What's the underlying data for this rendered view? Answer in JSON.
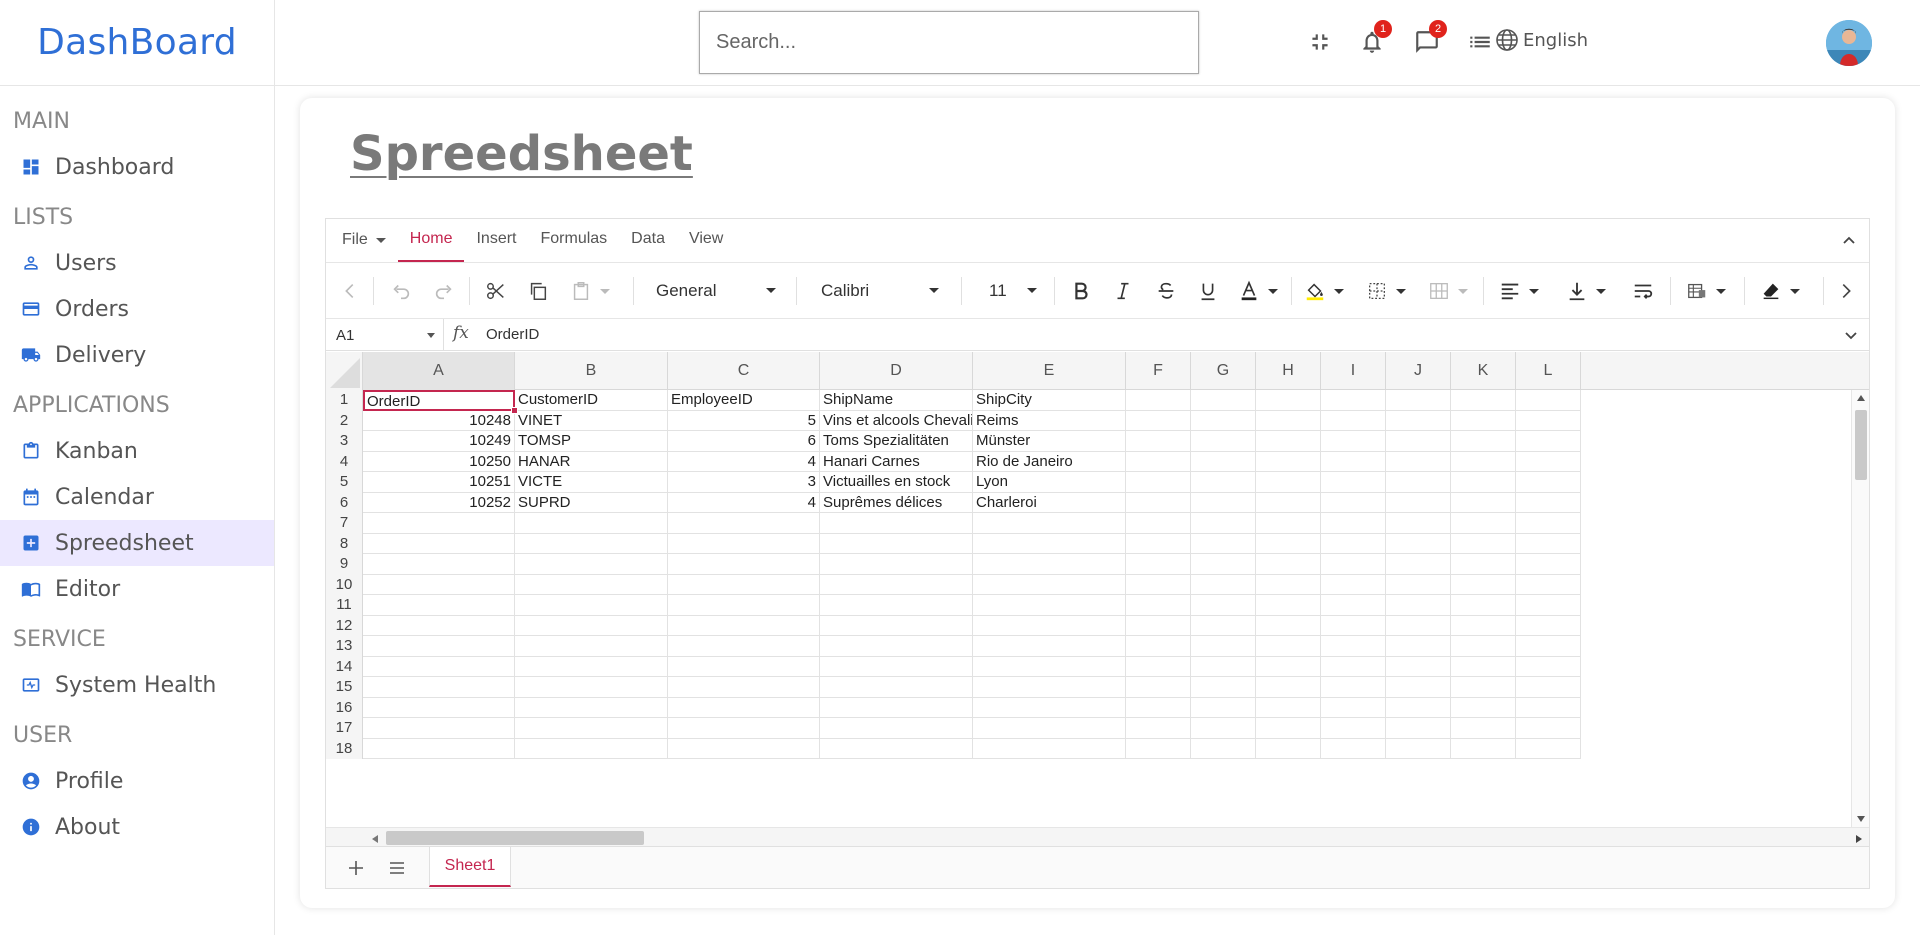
{
  "app": {
    "logo": "DashBoard"
  },
  "search": {
    "placeholder": "Search..."
  },
  "topbar": {
    "language": "English",
    "notifications_count": "1",
    "messages_count": "2"
  },
  "sidebar": {
    "sections": [
      {
        "title": "MAIN",
        "items": [
          {
            "label": "Dashboard",
            "icon": "dashboard-icon"
          }
        ]
      },
      {
        "title": "LISTS",
        "items": [
          {
            "label": "Users",
            "icon": "user-icon"
          },
          {
            "label": "Orders",
            "icon": "credit-card-icon"
          },
          {
            "label": "Delivery",
            "icon": "truck-icon"
          }
        ]
      },
      {
        "title": "APPLICATIONS",
        "items": [
          {
            "label": "Kanban",
            "icon": "clipboard-icon"
          },
          {
            "label": "Calendar",
            "icon": "calendar-icon"
          },
          {
            "label": "Spreedsheet",
            "icon": "spreadsheet-icon",
            "active": true
          },
          {
            "label": "Editor",
            "icon": "book-icon"
          }
        ]
      },
      {
        "title": "SERVICE",
        "items": [
          {
            "label": "System Health",
            "icon": "monitor-heart-icon"
          }
        ]
      },
      {
        "title": "USER",
        "items": [
          {
            "label": "Profile",
            "icon": "account-circle-icon"
          },
          {
            "label": "About",
            "icon": "info-icon"
          }
        ]
      }
    ]
  },
  "page": {
    "title": "Spreedsheet"
  },
  "spreadsheet": {
    "tabs": [
      "File",
      "Home",
      "Insert",
      "Formulas",
      "Data",
      "View"
    ],
    "active_tab": "Home",
    "number_format": "General",
    "font_family": "Calibri",
    "font_size": "11",
    "name_box": "A1",
    "formula_value": "OrderID",
    "columns": [
      "A",
      "B",
      "C",
      "D",
      "E",
      "F",
      "G",
      "H",
      "I",
      "J",
      "K",
      "L"
    ],
    "rows": [
      "1",
      "2",
      "3",
      "4",
      "5",
      "6",
      "7",
      "8",
      "9",
      "10",
      "11",
      "12",
      "13",
      "14",
      "15",
      "16",
      "17",
      "18"
    ],
    "data": [
      [
        "OrderID",
        "CustomerID",
        "EmployeeID",
        "ShipName",
        "ShipCity"
      ],
      [
        "10248",
        "VINET",
        "5",
        "Vins et alcools Chevalier",
        "Reims"
      ],
      [
        "10249",
        "TOMSP",
        "6",
        "Toms Spezialitäten",
        "Münster"
      ],
      [
        "10250",
        "HANAR",
        "4",
        "Hanari Carnes",
        "Rio de Janeiro"
      ],
      [
        "10251",
        "VICTE",
        "3",
        "Victuailles en stock",
        "Lyon"
      ],
      [
        "10252",
        "SUPRD",
        "4",
        "Suprêmes délices",
        "Charleroi"
      ]
    ],
    "sheet_tabs": [
      "Sheet1"
    ],
    "accent_color": "#c4264f"
  },
  "colors": {
    "brand": "#2f6fd6",
    "active_nav_bg": "#ece8ff",
    "badge": "#e0231c"
  }
}
